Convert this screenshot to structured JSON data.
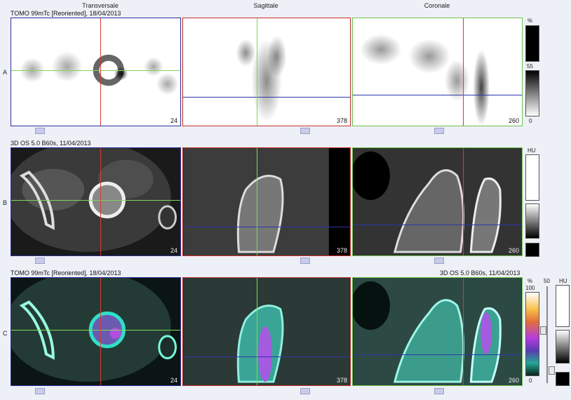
{
  "headers": {
    "transversal": "Transversale",
    "sagittal": "Sagittale",
    "coronal": "Coronale"
  },
  "rows": [
    {
      "letter": "A",
      "title": "TOMO 99mTc [Reoriented], 18/04/2013",
      "title_right": ""
    },
    {
      "letter": "B",
      "title": "3D  OS  5.0  B60s, 11/04/2013",
      "title_right": ""
    },
    {
      "letter": "C",
      "title": "TOMO 99mTc [Reoriented], 18/04/2013",
      "title_right": "3D  OS  5.0  B60s, 11/04/2013"
    }
  ],
  "slices": {
    "transversal": "24",
    "sagittal": "378",
    "coronal": "260"
  },
  "scales": {
    "pet_unit": "%",
    "pet_max": "55",
    "pet_min": "0",
    "ct_unit": "HU",
    "fusion_unit": "%",
    "fusion_max": "100",
    "fusion_min": "0",
    "fusion_mix": "50",
    "fusion_ct_unit": "HU"
  },
  "colors": {
    "crosshair_red": "#d83a30",
    "crosshair_green": "#7ed957",
    "crosshair_blue": "#2d36a8",
    "accent": "#2b2f9a"
  }
}
